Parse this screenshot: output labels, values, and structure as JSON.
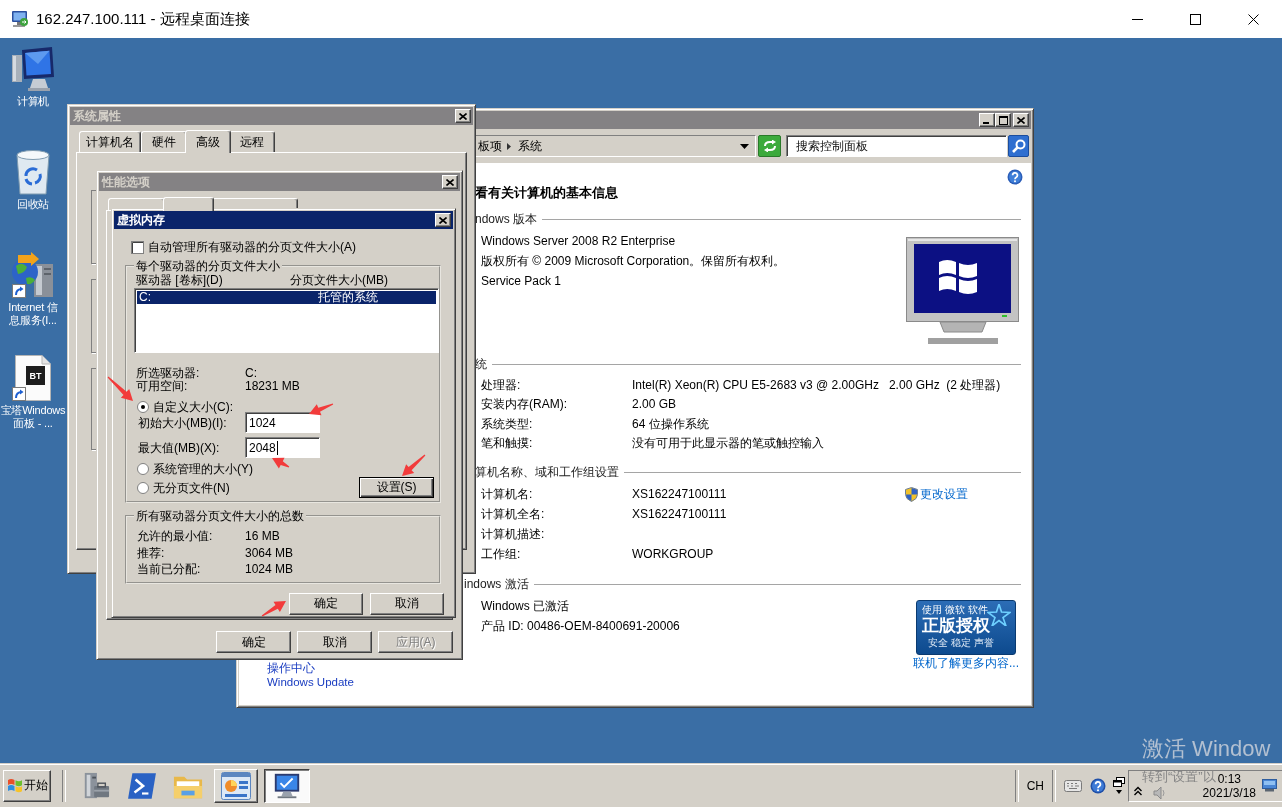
{
  "window": {
    "title": "162.247.100.111 - 远程桌面连接"
  },
  "desktop_icons": [
    {
      "kind": "computer",
      "label": "计算机"
    },
    {
      "kind": "recycle-bin",
      "label": "回收站"
    },
    {
      "kind": "web-server",
      "label": "Internet 信息服务(I..."
    },
    {
      "kind": "document",
      "logo": "BT",
      "label": "宝塔Windows面板 - ..."
    }
  ],
  "control_panel": {
    "address": {
      "crumbs": [
        "板项",
        "系统"
      ]
    },
    "search": {
      "placeholder": "搜索控制面板"
    },
    "heading": "看有关计算机的基本信息",
    "edition": {
      "title": "ndows 版本",
      "lines": [
        "Windows Server 2008 R2 Enterprise",
        "版权所有 © 2009 Microsoft Corporation。保留所有权利。",
        "Service Pack 1"
      ]
    },
    "system": {
      "title": "统",
      "rows": [
        {
          "label": "处理器:",
          "value": "Intel(R) Xeon(R) CPU E5-2683 v3 @ 2.00GHz   2.00 GHz  (2 处理器)"
        },
        {
          "label": "安装内存(RAM):",
          "value": "2.00 GB"
        },
        {
          "label": "系统类型:",
          "value": "64 位操作系统"
        },
        {
          "label": "笔和触摸:",
          "value": "没有可用于此显示器的笔或触控输入"
        }
      ]
    },
    "computer_name": {
      "title": "算机名称、域和工作组设置",
      "rows": [
        {
          "label": "计算机名:",
          "value": "XS162247100111"
        },
        {
          "label": "计算机全名:",
          "value": "XS162247100111"
        },
        {
          "label": "计算机描述:"
        },
        {
          "label": "工作组:",
          "value": "WORKGROUP"
        }
      ],
      "link": "更改设置"
    },
    "activation": {
      "title": "indows 激活",
      "lines": [
        "Windows 已激活",
        "产品 ID: 00486-OEM-8400691-20006"
      ],
      "badge": [
        "使用 微软 软件",
        "正版授权",
        "安全 稳定 声誉"
      ],
      "link": "联机了解更多内容..."
    },
    "nav_links": [
      "操作中心",
      "Windows Update"
    ]
  },
  "system_properties": {
    "title": "系统属性",
    "tabs": [
      {
        "label": "计算机名",
        "selected": false
      },
      {
        "label": "硬件",
        "selected": false
      },
      {
        "label": "高级",
        "selected": true
      },
      {
        "label": "远程",
        "selected": false
      }
    ]
  },
  "performance_options": {
    "title": "性能选项",
    "tabs": [
      {
        "selected": false
      },
      {
        "selected": true
      },
      {
        "selected": false
      }
    ],
    "buttons": [
      {
        "label": "确定",
        "disabled": false
      },
      {
        "label": "取消",
        "disabled": false
      },
      {
        "label": "应用(A)",
        "disabled": true
      }
    ]
  },
  "virtual_memory": {
    "title": "虚拟内存",
    "auto_manage": {
      "label": "自动管理所有驱动器的分页文件大小(A)",
      "checked": false
    },
    "per_drive": {
      "title": "每个驱动器的分页文件大小",
      "columns": [
        "驱动器 [卷标](D)",
        "分页文件大小(MB)"
      ],
      "rows": [
        {
          "drive": "C:",
          "size": "托管的系统",
          "selected": true
        }
      ],
      "selected_drive": {
        "label": "所选驱动器:",
        "value": "C:"
      },
      "free_space": {
        "label": "可用空间:",
        "value": "18231 MB"
      },
      "options": [
        {
          "label": "自定义大小(C):",
          "selected": true
        },
        {
          "label": "系统管理的大小(Y)",
          "selected": false
        },
        {
          "label": "无分页文件(N)",
          "selected": false
        }
      ],
      "initial_size": {
        "label": "初始大小(MB)(I):",
        "value": "1024",
        "focused": false
      },
      "maximum_size": {
        "label": "最大值(MB)(X):",
        "value": "2048",
        "focused": true
      },
      "set_button": {
        "label": "设置(S)",
        "default": true
      }
    },
    "totals": {
      "title": "所有驱动器分页文件大小的总数",
      "rows": [
        {
          "label": "允许的最小值:",
          "value": "16 MB"
        },
        {
          "label": "推荐:",
          "value": "3064 MB"
        },
        {
          "label": "当前已分配:",
          "value": "1024 MB"
        }
      ]
    },
    "buttons": [
      {
        "label": "确定"
      },
      {
        "label": "取消"
      }
    ]
  },
  "taskbar": {
    "start": "开始",
    "items": [
      {
        "kind": "server-manager",
        "open": false,
        "selected": false
      },
      {
        "kind": "powershell",
        "open": false,
        "selected": false
      },
      {
        "kind": "explorer",
        "open": false,
        "selected": false
      },
      {
        "kind": "control-panel",
        "open": true,
        "selected": false
      },
      {
        "kind": "computer",
        "open": true,
        "selected": true
      }
    ],
    "input_language": "CH",
    "time": "0:13",
    "date": "2021/3/18"
  },
  "activation_watermark": {
    "title": "激活 Window",
    "text": "转到“设置”以"
  }
}
